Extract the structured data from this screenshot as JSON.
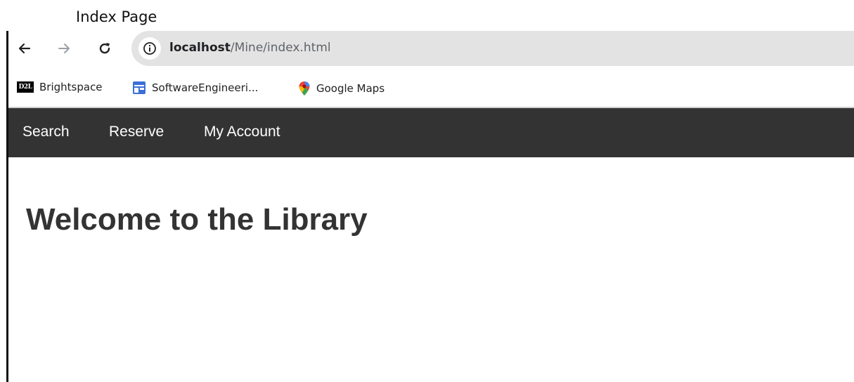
{
  "caption": "Index Page",
  "browser": {
    "url_host": "localhost",
    "url_path": "/Mine/index.html"
  },
  "bookmarks": [
    {
      "label": "Brightspace",
      "icon": "d2l-icon",
      "icon_text": "D2L"
    },
    {
      "label": "SoftwareEngineeri...",
      "icon": "calendar-icon"
    },
    {
      "label": "Google Maps",
      "icon": "maps-pin-icon"
    }
  ],
  "site_nav": {
    "items": [
      "Search",
      "Reserve",
      "My Account"
    ]
  },
  "main": {
    "heading": "Welcome to the Library"
  },
  "colors": {
    "nav_background": "#333333",
    "nav_text": "#ffffff",
    "heading_text": "#333333",
    "omnibox": "#e3e3e3"
  }
}
